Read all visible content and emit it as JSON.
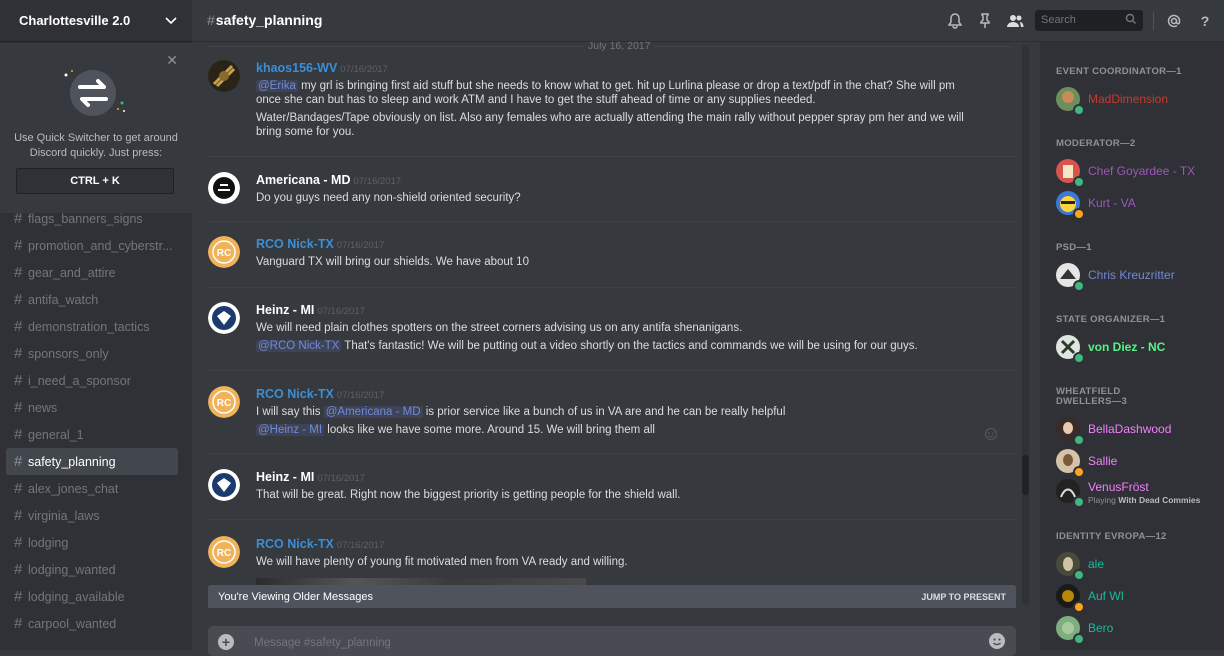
{
  "server": {
    "name": "Charlottesville 2.0"
  },
  "quick_switcher": {
    "text_line1": "Use Quick Switcher to get around",
    "text_line2": "Discord quickly. Just press:",
    "shortcut": "CTRL + K"
  },
  "channels": [
    {
      "name": "flags_banners_signs"
    },
    {
      "name": "promotion_and_cyberstr..."
    },
    {
      "name": "gear_and_attire"
    },
    {
      "name": "antifa_watch"
    },
    {
      "name": "demonstration_tactics"
    },
    {
      "name": "sponsors_only"
    },
    {
      "name": "i_need_a_sponsor"
    },
    {
      "name": "news"
    },
    {
      "name": "general_1"
    },
    {
      "name": "safety_planning",
      "active": true
    },
    {
      "name": "alex_jones_chat"
    },
    {
      "name": "virginia_laws"
    },
    {
      "name": "lodging"
    },
    {
      "name": "lodging_wanted"
    },
    {
      "name": "lodging_available"
    },
    {
      "name": "carpool_wanted"
    }
  ],
  "header": {
    "channel_name": "safety_planning",
    "search_placeholder": "Search",
    "icons": [
      "bell-icon",
      "pin-icon",
      "members-icon",
      "search-icon",
      "at-icon",
      "help-icon"
    ]
  },
  "date_divider": "July 16, 2017",
  "messages": [
    {
      "author": "khaos156-WV",
      "timestamp": "07/16/2017",
      "lines": [
        {
          "mention": "@Erika",
          "text": " my grl is bringing first aid stuff but she needs to know what to get. hit up Lurlina please or drop a text/pdf in the chat? She will pm once she can but has to sleep and work ATM and I have to get the stuff ahead of time or any supplies needed."
        },
        {
          "text": "Water/Bandages/Tape obviously on list. Also any females who are actually attending the main rally without pepper spray pm her and we will bring some for you."
        }
      ]
    },
    {
      "author": "Americana - MD",
      "timestamp": "07/16/2017",
      "lines": [
        {
          "text": "Do you guys need any non-shield oriented security?"
        }
      ]
    },
    {
      "author": "RCO Nick-TX",
      "timestamp": "07/16/2017",
      "lines": [
        {
          "text": "Vanguard TX will bring our shields. We have about 10"
        }
      ]
    },
    {
      "author": "Heinz - MI",
      "timestamp": "07/16/2017",
      "lines": [
        {
          "text": "We will need plain clothes spotters on the street corners advising us on any antifa shenanigans."
        },
        {
          "mention": "@RCO Nick-TX",
          "text": " That's fantastic! We will be putting out a video shortly on the tactics and commands we will be using for our guys."
        }
      ]
    },
    {
      "author": "RCO Nick-TX",
      "timestamp": "07/16/2017",
      "lines": [
        {
          "pre": "I will say this ",
          "mention": "@Americana - MD",
          "text": " is prior service like a bunch of us in VA are and he can be really helpful"
        },
        {
          "mention": "@Heinz - MI",
          "text": " looks like we have some more. Around 15. We will bring them all"
        }
      ]
    },
    {
      "author": "Heinz - MI",
      "timestamp": "07/16/2017",
      "lines": [
        {
          "text": "That will be great. Right now the biggest priority is getting people for the shield wall."
        }
      ]
    },
    {
      "author": "RCO Nick-TX",
      "timestamp": "07/16/2017",
      "lines": [
        {
          "text": "We will have plenty of young fit motivated men from VA ready and willing."
        }
      ]
    }
  ],
  "older_bar": {
    "text": "You're Viewing Older Messages",
    "jump": "JUMP TO PRESENT"
  },
  "composer": {
    "placeholder": "Message #safety_planning"
  },
  "members": {
    "roles": [
      {
        "title": "EVENT COORDINATOR—1"
      },
      {
        "title": "MODERATOR—2"
      },
      {
        "title": "PSD—1"
      },
      {
        "title": "STATE ORGANIZER—1"
      },
      {
        "title": "WHEATFIELD DWELLERS—3"
      },
      {
        "title": "IDENTITY EVROPA—12"
      }
    ],
    "list": [
      {
        "name": "MadDimension",
        "color": "#c93a2f",
        "status": "online"
      },
      {
        "name": "Chef Goyardee - TX",
        "color": "#9b59b6",
        "status": "online"
      },
      {
        "name": "Kurt - VA",
        "color": "#9b59b6",
        "status": "idle"
      },
      {
        "name": "Chris Kreuzritter",
        "color": "#7289da",
        "status": "online"
      },
      {
        "name": "von Diez - NC",
        "color": "#57f287",
        "status": "online"
      },
      {
        "name": "BellaDashwood",
        "color": "#f47fff",
        "status": "online"
      },
      {
        "name": "Sallie",
        "color": "#f47fff",
        "status": "idle"
      },
      {
        "name": "VenusFröst",
        "color": "#f47fff",
        "status": "online",
        "activity_prefix": "Playing ",
        "activity": "With Dead Commies"
      },
      {
        "name": "ale",
        "color": "#1abc9c",
        "status": "online"
      },
      {
        "name": "Auf WI",
        "color": "#1abc9c",
        "status": "idle"
      },
      {
        "name": "Bero",
        "color": "#1abc9c",
        "status": "online"
      }
    ]
  }
}
